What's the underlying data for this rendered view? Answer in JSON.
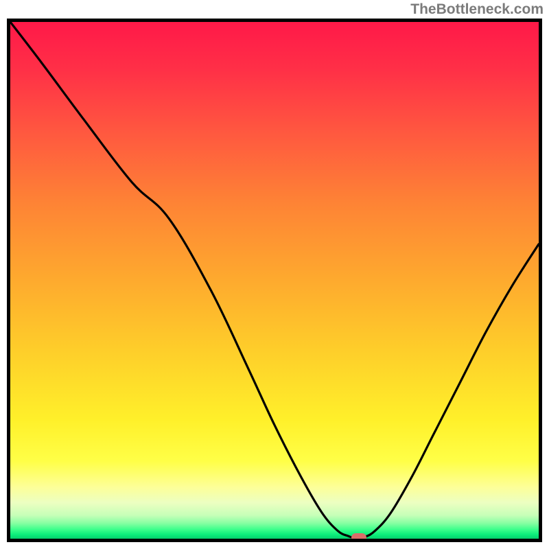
{
  "watermark": "TheBottleneck.com",
  "colors": {
    "border": "#000000",
    "curve": "#000000",
    "marker": "#da6e69",
    "gradient_top": "#ff1948",
    "gradient_bottom": "#06d06c"
  },
  "chart_data": {
    "type": "line",
    "title": "",
    "xlabel": "",
    "ylabel": "",
    "xlim": [
      0,
      100
    ],
    "ylim": [
      0,
      100
    ],
    "grid": false,
    "legend": false,
    "annotations": [
      "TheBottleneck.com"
    ],
    "series": [
      {
        "name": "bottleneck-curve",
        "x": [
          0,
          6,
          14,
          23,
          30,
          38,
          45,
          50,
          55,
          59,
          62,
          64,
          65.5,
          67,
          69,
          72,
          76,
          80,
          85,
          90,
          95,
          100
        ],
        "values": [
          100,
          92,
          81,
          69,
          62,
          48,
          33,
          22,
          12,
          5,
          1.5,
          0.5,
          0,
          0.3,
          1.5,
          5,
          12,
          20,
          30,
          40,
          49,
          57
        ]
      }
    ],
    "marker": {
      "x": 66,
      "y": 0
    }
  }
}
